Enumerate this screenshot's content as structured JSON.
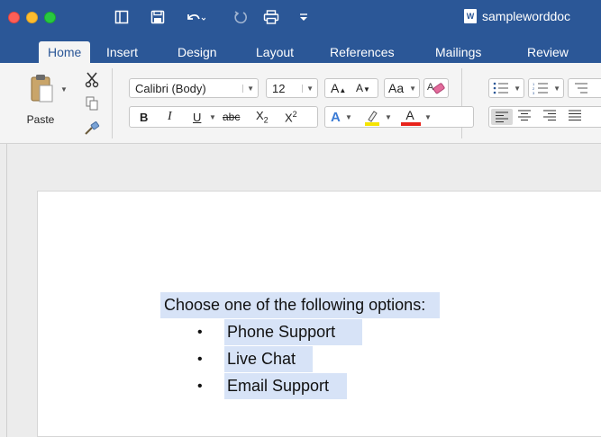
{
  "window": {
    "title": "sampleworddoc",
    "doc_icon_letter": "W"
  },
  "tabs": [
    {
      "label": "Home",
      "active": true
    },
    {
      "label": "Insert"
    },
    {
      "label": "Design"
    },
    {
      "label": "Layout"
    },
    {
      "label": "References"
    },
    {
      "label": "Mailings"
    },
    {
      "label": "Review"
    }
  ],
  "clipboard": {
    "paste_label": "Paste"
  },
  "font": {
    "family": "Calibri (Body)",
    "size": "12",
    "bold": "B",
    "italic": "I",
    "underline": "U",
    "strikethrough": "abc",
    "subscript": "X",
    "subscript_sub": "2",
    "superscript": "X",
    "superscript_sup": "2",
    "grow": "A",
    "shrink": "A",
    "change_case": "Aa",
    "text_effects": "A",
    "font_color": "A"
  },
  "colors": {
    "title_bar": "#2b5797",
    "selection": "#d7e3f7",
    "highlight": "#f5e400",
    "font_color_bar": "#e8231b"
  },
  "document": {
    "intro": "Choose one of the following options:",
    "bullet_symbol": "•",
    "items": [
      "Phone Support",
      "Live Chat",
      "Email Support"
    ]
  }
}
